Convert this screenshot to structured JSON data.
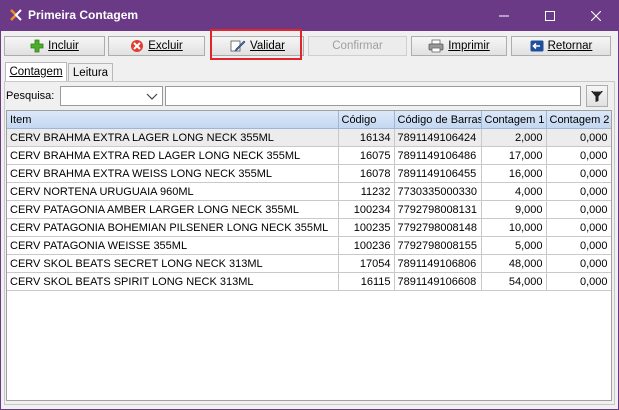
{
  "window": {
    "title": "Primeira Contagem",
    "minimize_glyph": "–",
    "maximize_glyph": "☐",
    "close_glyph": "✕"
  },
  "toolbar": {
    "incluir": "Incluir",
    "excluir": "Excluir",
    "validar": "Validar",
    "confirmar": "Confirmar",
    "imprimir": "Imprimir",
    "retornar": "Retornar"
  },
  "tabs": [
    "Contagem",
    "Leitura"
  ],
  "search": {
    "label": "Pesquisa:",
    "field_value": "",
    "text_value": ""
  },
  "table": {
    "columns": [
      "Item",
      "Código",
      "Código de Barras",
      "Contagem 1",
      "Contagem 2"
    ],
    "rows": [
      [
        "CERV BRAHMA EXTRA LAGER LONG NECK 355ML",
        "16134",
        "7891149106424",
        "2,000",
        "0,000"
      ],
      [
        "CERV BRAHMA EXTRA RED LAGER LONG NECK 355ML",
        "16075",
        "7891149106486",
        "17,000",
        "0,000"
      ],
      [
        "CERV BRAHMA EXTRA WEISS LONG NECK 355ML",
        "16078",
        "7891149106455",
        "16,000",
        "0,000"
      ],
      [
        "CERV NORTENA URUGUAIA 960ML",
        "11232",
        "7730335000330",
        "4,000",
        "0,000"
      ],
      [
        "CERV PATAGONIA AMBER LARGER LONG NECK 355ML",
        "100234",
        "7792798008131",
        "9,000",
        "0,000"
      ],
      [
        "CERV PATAGONIA BOHEMIAN PILSENER LONG NECK 355ML",
        "100235",
        "7792798008148",
        "10,000",
        "0,000"
      ],
      [
        "CERV PATAGONIA WEISSE 355ML",
        "100236",
        "7792798008155",
        "5,000",
        "0,000"
      ],
      [
        "CERV SKOL BEATS SECRET LONG NECK 313ML",
        "17054",
        "7891149106806",
        "48,000",
        "0,000"
      ],
      [
        "CERV SKOL BEATS SPIRIT LONG NECK 313ML",
        "16115",
        "7891149106608",
        "54,000",
        "0,000"
      ]
    ]
  },
  "colors": {
    "titlebar": "#6b3a86",
    "highlight": "#e0262c",
    "header": "#c4d8f2"
  }
}
